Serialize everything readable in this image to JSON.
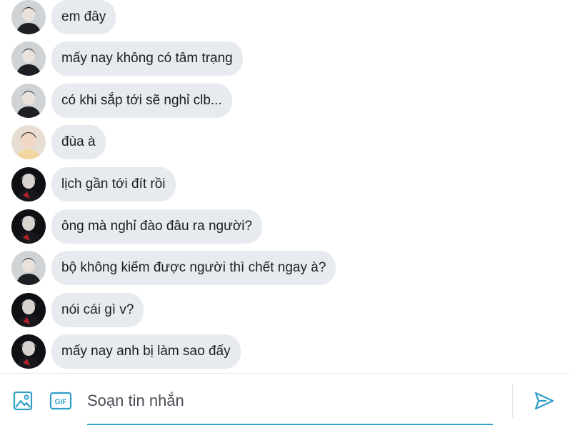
{
  "messages": [
    {
      "text": "em đây",
      "avatar": "user-a"
    },
    {
      "text": "mấy nay không có tâm trạng",
      "avatar": "user-a"
    },
    {
      "text": "có khi sắp tới sẽ nghỉ clb...",
      "avatar": "user-a"
    },
    {
      "text": "đùa à",
      "avatar": "user-b"
    },
    {
      "text": "lịch gần tới đít rồi",
      "avatar": "user-c"
    },
    {
      "text": "ông mà nghỉ đào đâu ra người?",
      "avatar": "user-c"
    },
    {
      "text": "bộ không kiếm được người thì chết ngay à?",
      "avatar": "user-a"
    },
    {
      "text": "nói cái gì v?",
      "avatar": "user-c"
    },
    {
      "text": "mấy nay anh bị làm sao đấy",
      "avatar": "user-c"
    }
  ],
  "composer": {
    "placeholder": "Soạn tin nhắn",
    "gif_label": "GIF",
    "icons": [
      "image-icon",
      "gif-icon",
      "send-icon"
    ]
  },
  "colors": {
    "bubble": "#e7ebf0",
    "accent": "#2f9fc8",
    "icon": "#2f9fc8"
  }
}
